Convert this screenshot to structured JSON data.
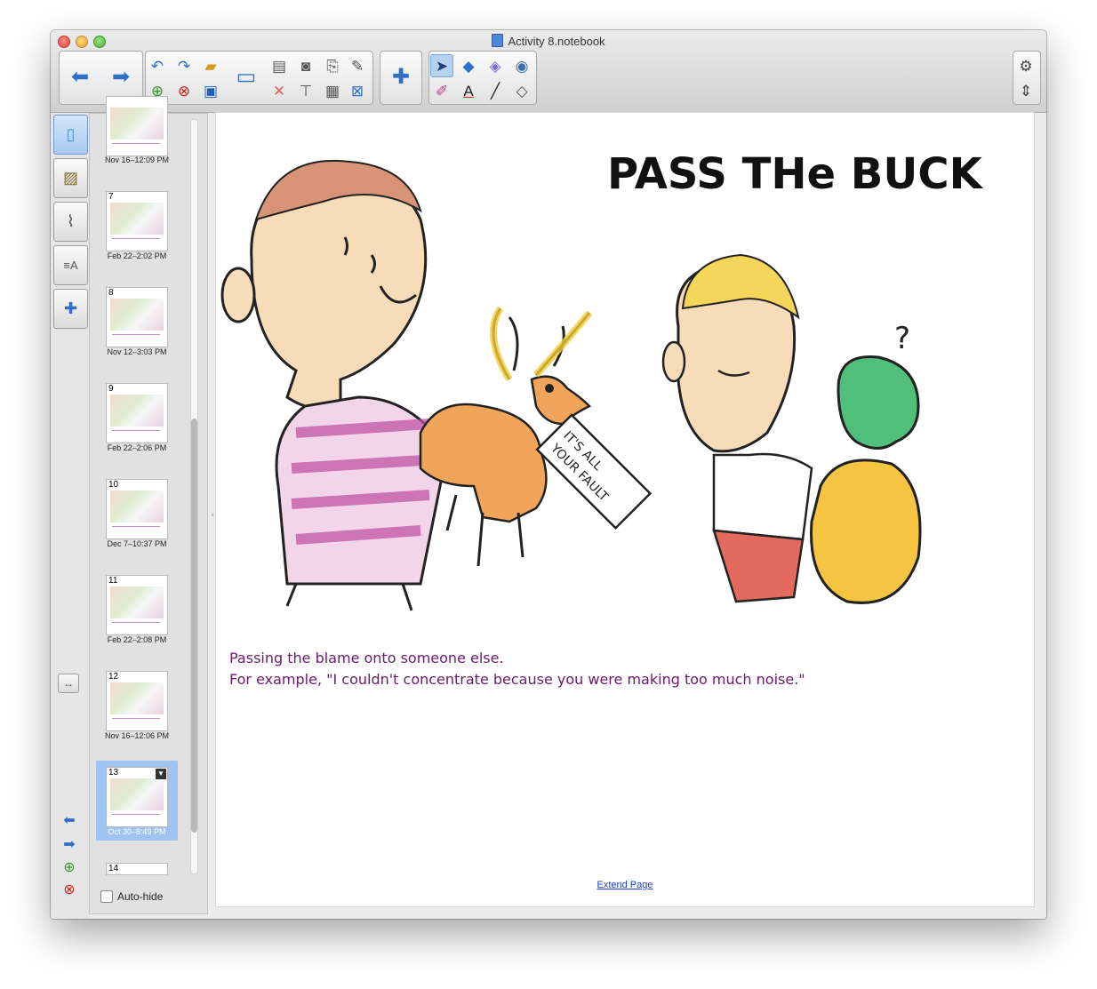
{
  "window": {
    "title": "Activity 8.notebook"
  },
  "toolbar": {
    "icons": [
      "arrow-left-icon",
      "arrow-right-icon",
      "undo-icon",
      "redo-icon",
      "open-folder-icon",
      "add-page-icon",
      "delete-page-icon",
      "save-icon",
      "screen-icon",
      "paste-icon",
      "screen-capture-icon",
      "clear-icon",
      "table-icon",
      "pen-selection-icon",
      "puzzle-icon",
      "select-pointer-icon",
      "shapes-icon",
      "highlighter-icon",
      "fill-icon",
      "pens-icon",
      "text-icon",
      "line-icon",
      "eraser-icon",
      "gear-icon",
      "expand-icon"
    ]
  },
  "sidebar": {
    "tabs": [
      "page-sorter",
      "gallery",
      "attachments",
      "properties",
      "add-ons"
    ],
    "autohide_label": "Auto-hide",
    "resize_label": "↔"
  },
  "sorter": {
    "thumbs": [
      {
        "num": "",
        "date": "Nov 16–12:09 PM"
      },
      {
        "num": "7",
        "date": "Feb 22–2:02 PM"
      },
      {
        "num": "8",
        "date": "Nov 12–3:03 PM"
      },
      {
        "num": "9",
        "date": "Feb 22–2:06 PM"
      },
      {
        "num": "10",
        "date": "Dec 7–10:37 PM"
      },
      {
        "num": "11",
        "date": "Feb 22–2:08 PM"
      },
      {
        "num": "12",
        "date": "Nov 16–12:06 PM"
      },
      {
        "num": "13",
        "date": "Oct 30–8:49 PM"
      },
      {
        "num": "14",
        "date": ""
      }
    ]
  },
  "page": {
    "heading": "PASS THe BUCK",
    "tag_text": "IT'S ALL YOUR FAULT",
    "caption_line1": "Passing the blame onto someone else.",
    "caption_line2": "For example, \"I couldn't concentrate because you were making too much noise.\"",
    "extend_link": "Extend Page"
  },
  "colors": {
    "caption": "#6b1a6b",
    "accent": "#2f6fc7",
    "selection": "#9ec4ef"
  }
}
